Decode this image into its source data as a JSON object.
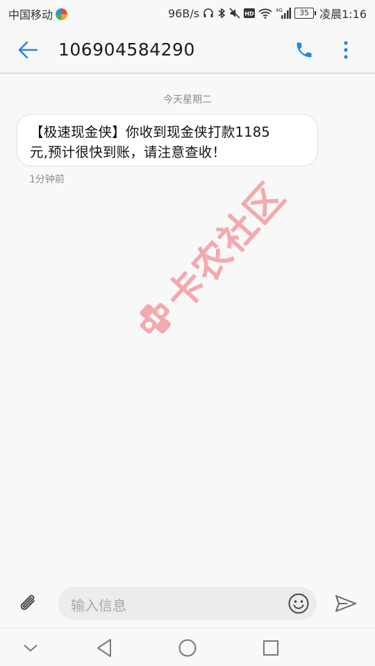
{
  "status_bar": {
    "carrier": "中国移动",
    "speed": "96B/s",
    "signal_tag": "4G",
    "battery": "35",
    "time": "凌晨1:16"
  },
  "header": {
    "title": "106904584290"
  },
  "conversation": {
    "date_separator": "今天星期二",
    "messages": [
      {
        "text": "【极速现金侠】你收到现金侠打款1185\n元,预计很快到账，请注意查收！",
        "time": "1分钟前"
      }
    ]
  },
  "watermark": {
    "text": "卡农社区"
  },
  "composer": {
    "placeholder": "输入信息"
  },
  "icons": {
    "back": "arrow-left-icon",
    "call": "phone-icon",
    "more": "more-vertical-icon",
    "attach": "paperclip-icon",
    "emoji": "smiley-icon",
    "send": "send-icon",
    "nav": [
      "chevron-down-icon",
      "back-triangle-icon",
      "home-circle-icon",
      "recents-square-icon"
    ]
  },
  "colors": {
    "accent": "#1e88e5",
    "watermark": "#ef6a70"
  }
}
